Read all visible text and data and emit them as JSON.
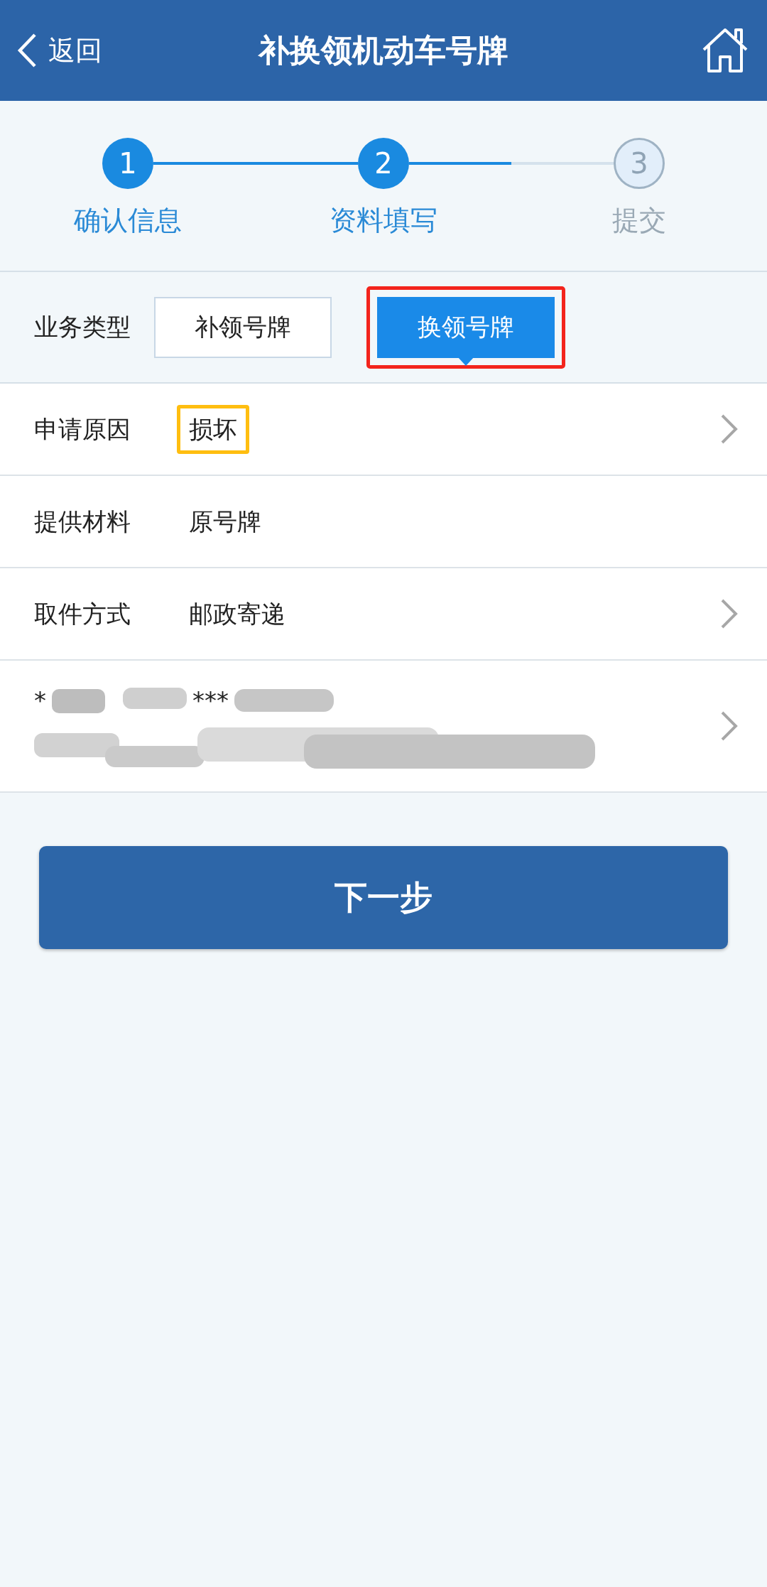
{
  "header": {
    "back": "返回",
    "title": "补换领机动车号牌"
  },
  "steps": [
    {
      "number": "1",
      "label": "确认信息",
      "completed": true,
      "current": false
    },
    {
      "number": "2",
      "label": "资料填写",
      "completed": false,
      "current": true
    },
    {
      "number": "3",
      "label": "提交",
      "completed": false,
      "current": false
    }
  ],
  "business_type": {
    "label": "业务类型",
    "options": [
      {
        "label": "补领号牌",
        "selected": false,
        "outlined": false
      },
      {
        "label": "换领号牌",
        "selected": true,
        "outlined": true
      }
    ]
  },
  "rows": [
    {
      "label": "申请原因",
      "value": "损坏",
      "chevron": true,
      "outlined": true
    },
    {
      "label": "提供材料",
      "value": "原号牌",
      "chevron": false,
      "outlined": false
    },
    {
      "label": "取件方式",
      "value": "邮政寄递",
      "chevron": true,
      "outlined": false
    }
  ],
  "address": {
    "visible_parts": [
      "*",
      "***"
    ],
    "redacted": true,
    "chevron": true
  },
  "next_button": "下一步"
}
